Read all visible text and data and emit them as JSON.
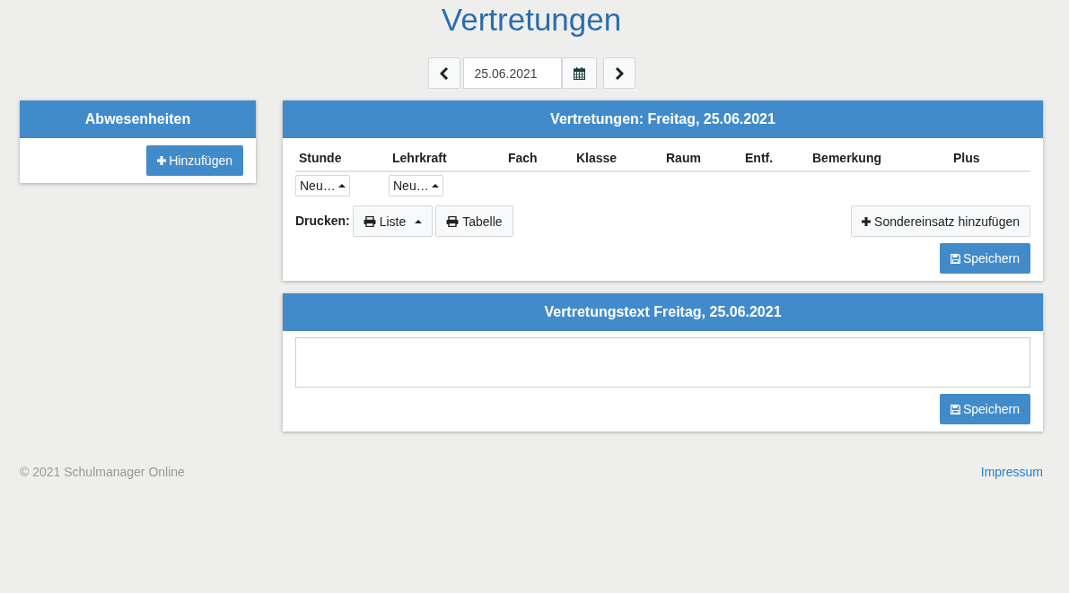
{
  "title": "Vertretungen",
  "date_nav": {
    "date": "25.06.2021"
  },
  "absences_panel": {
    "title": "Abwesenheiten",
    "add_button": "Hinzufügen"
  },
  "substitutions_panel": {
    "title": "Vertretungen: Freitag, 25.06.2021",
    "columns": [
      "Stunde",
      "Lehrkraft",
      "Fach",
      "Klasse",
      "Raum",
      "Entf.",
      "Bemerkung",
      "Plus"
    ],
    "new_row": [
      "Neu…",
      "Neu…"
    ],
    "print_label": "Drucken:",
    "print_buttons": [
      {
        "label": "Liste",
        "kind": "dropdown"
      },
      {
        "label": "Tabelle",
        "kind": "plain"
      }
    ],
    "special_button": "Sondereinsatz hinzufügen",
    "save_button": "Speichern"
  },
  "text_panel": {
    "title": "Vertretungstext Freitag, 25.06.2021",
    "save_button": "Speichern"
  },
  "footer": {
    "copyright": "© 2021 Schulmanager Online",
    "link": "Impressum"
  }
}
